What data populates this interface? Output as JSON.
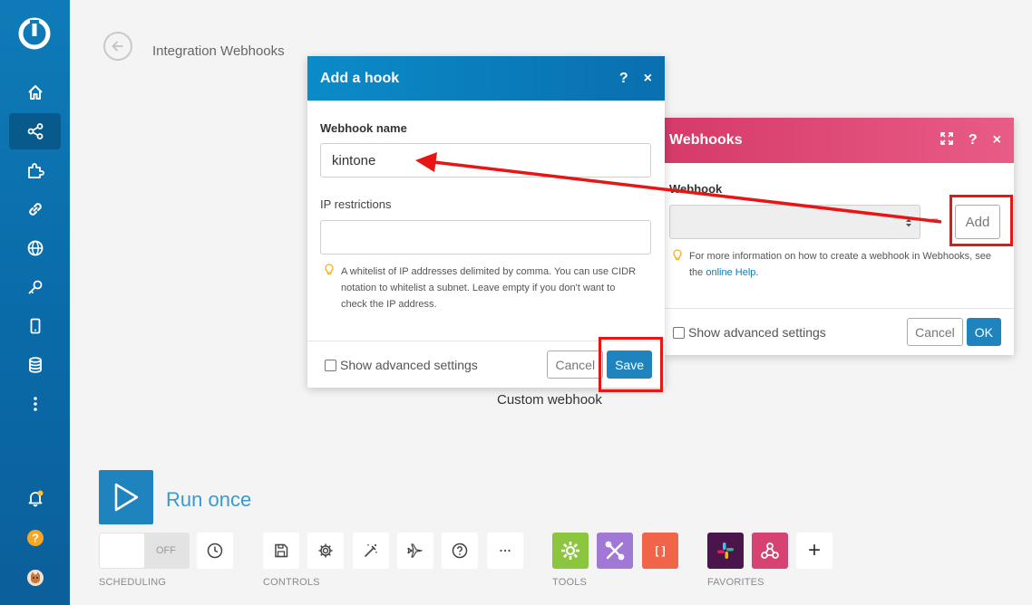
{
  "page": {
    "title": "Integration Webhooks"
  },
  "sidebar": {
    "items": [
      {
        "name": "home-icon"
      },
      {
        "name": "share-icon"
      },
      {
        "name": "puzzle-icon"
      },
      {
        "name": "link-icon"
      },
      {
        "name": "globe-icon"
      },
      {
        "name": "key-icon"
      },
      {
        "name": "mobile-icon"
      },
      {
        "name": "database-icon"
      },
      {
        "name": "more-icon"
      }
    ],
    "bottom": [
      {
        "name": "bell-icon"
      },
      {
        "name": "help-icon"
      },
      {
        "name": "avatar"
      }
    ]
  },
  "add_hook_dialog": {
    "title": "Add a hook",
    "help": "?",
    "close": "×",
    "webhook_name_label": "Webhook name",
    "webhook_name_value": "kintone",
    "ip_label": "IP restrictions",
    "ip_value": "",
    "ip_hint": "A whitelist of IP addresses delimited by comma. You can use CIDR notation to whitelist a subnet. Leave empty if you don't want to check the IP address.",
    "advanced": "Show advanced settings",
    "cancel": "Cancel",
    "save": "Save"
  },
  "webhooks_dialog": {
    "title": "Webhooks",
    "help": "?",
    "close": "×",
    "webhook_label": "Webhook",
    "webhook_value": "",
    "add": "Add",
    "hint_prefix": "For more information on how to create a webhook in Webhooks, see the ",
    "hint_link": "online Help",
    "hint_suffix": ".",
    "advanced": "Show advanced settings",
    "cancel": "Cancel",
    "ok": "OK"
  },
  "module_label": "Custom webhook",
  "toolbar": {
    "run_once": "Run once",
    "toggle_state": "OFF",
    "scheduling_label": "SCHEDULING",
    "controls_label": "CONTROLS",
    "tools_label": "TOOLS",
    "favorites_label": "FAVORITES",
    "tool_glyph": "[ ]",
    "add_glyph": "+"
  },
  "colors": {
    "sidebar": "#0a6aa8",
    "add_hook_header": "#0b84c4",
    "webhooks_header": "#e04874",
    "primary": "#1f84bd",
    "annotation": "#e81515"
  }
}
